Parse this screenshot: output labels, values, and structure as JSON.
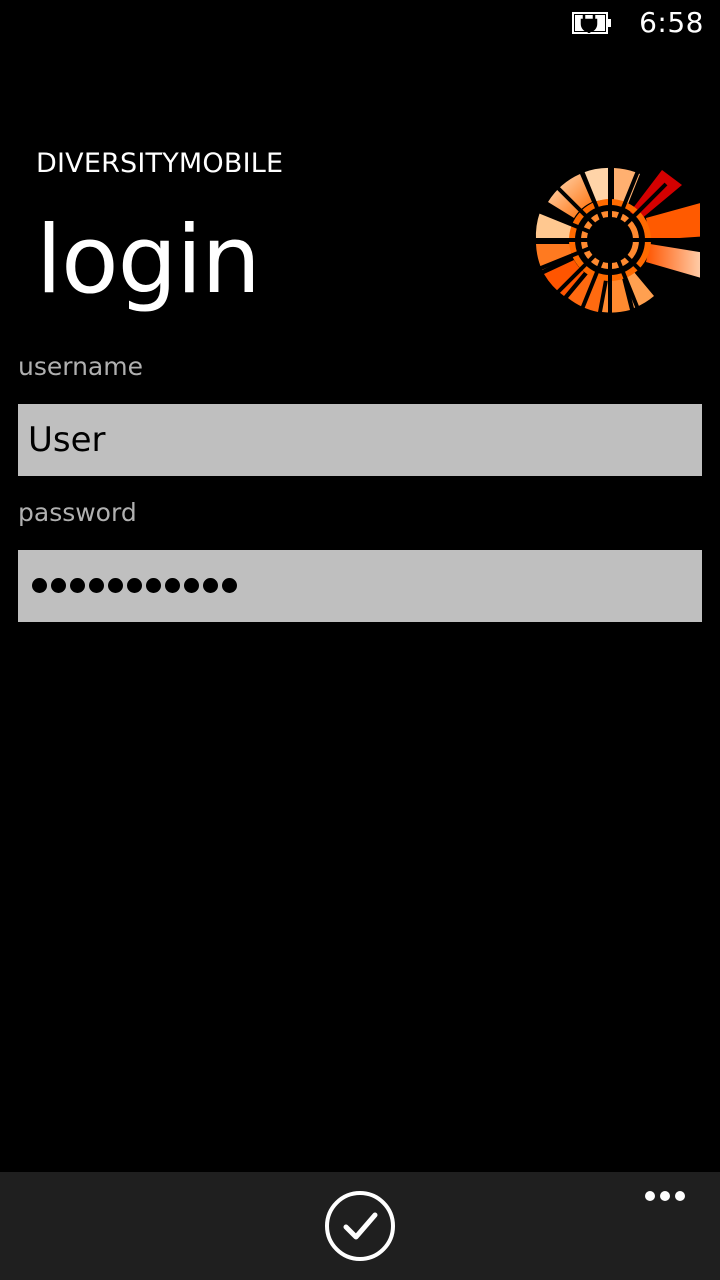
{
  "status_bar": {
    "time": "6:58",
    "battery_icon": "battery-charging-icon"
  },
  "header": {
    "app_title": "DIVERSITYMOBILE",
    "page_title": "login",
    "logo_icon": "diversity-logo-icon"
  },
  "form": {
    "username": {
      "label": "username",
      "value": "User"
    },
    "password": {
      "label": "password",
      "masked_length": 11
    }
  },
  "app_bar": {
    "confirm_icon": "checkmark-icon",
    "more_icon": "ellipsis-icon"
  },
  "colors": {
    "background": "#000000",
    "field_background": "#bfbfbf",
    "label": "#b0b0b0",
    "app_bar": "#1f1f1f",
    "logo_orange": "#ff6a00",
    "logo_red": "#cc0000"
  }
}
